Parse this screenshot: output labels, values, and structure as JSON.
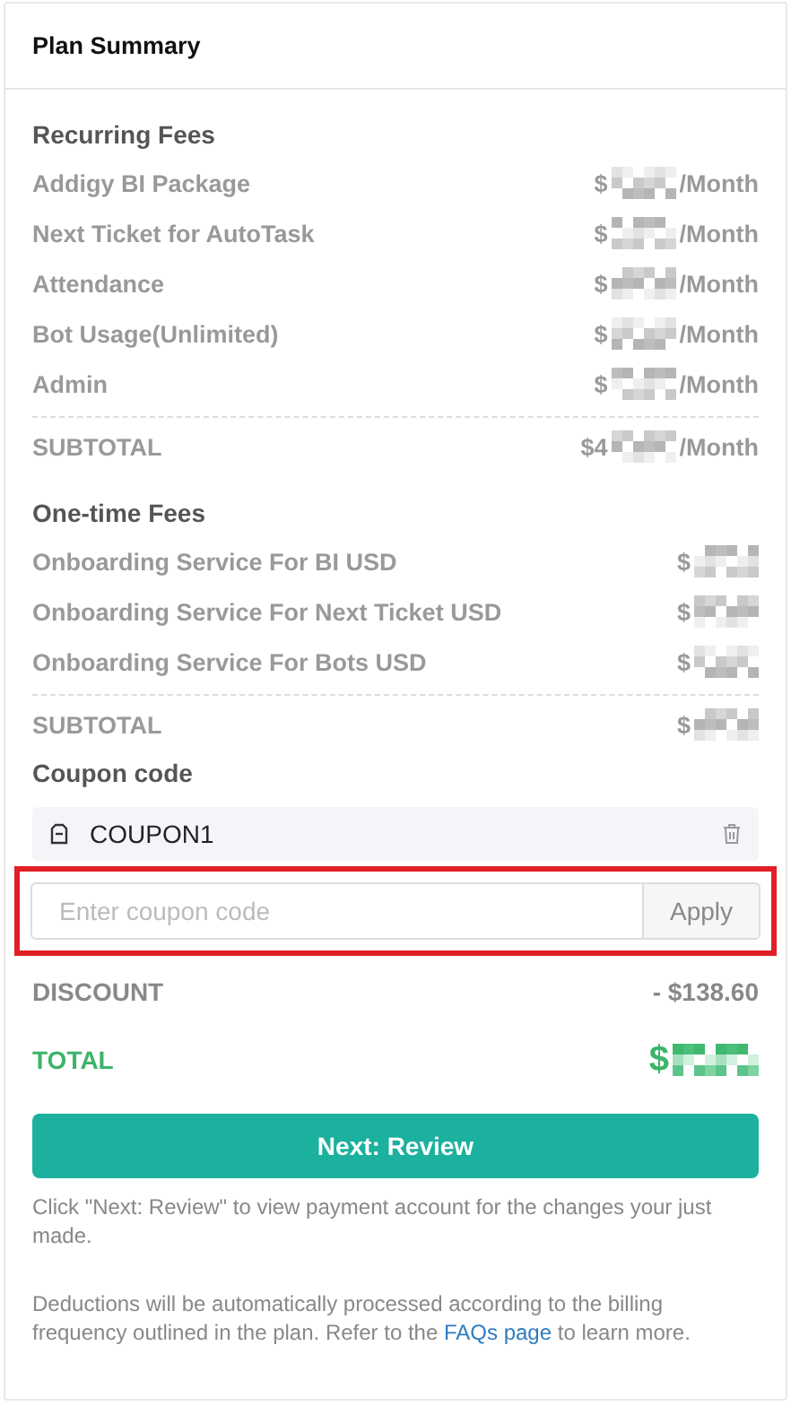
{
  "title": "Plan Summary",
  "recurring": {
    "heading": "Recurring Fees",
    "items": [
      {
        "label": "Addigy BI Package",
        "prefix": "$",
        "suffix": "/Month"
      },
      {
        "label": "Next Ticket for AutoTask",
        "prefix": "$",
        "suffix": "/Month"
      },
      {
        "label": "Attendance",
        "prefix": "$",
        "suffix": "/Month"
      },
      {
        "label": "Bot Usage(Unlimited)",
        "prefix": "$",
        "suffix": "/Month"
      },
      {
        "label": "Admin",
        "prefix": "$",
        "suffix": "/Month"
      }
    ],
    "subtotal": {
      "label": "SUBTOTAL",
      "prefix": "$4",
      "suffix": "/Month"
    }
  },
  "one_time": {
    "heading": "One-time Fees",
    "items": [
      {
        "label": "Onboarding Service For BI USD",
        "prefix": "$"
      },
      {
        "label": "Onboarding Service For Next Ticket USD",
        "prefix": "$"
      },
      {
        "label": "Onboarding Service For Bots USD",
        "prefix": "$"
      }
    ],
    "subtotal": {
      "label": "SUBTOTAL",
      "prefix": "$"
    }
  },
  "coupon": {
    "heading": "Coupon code",
    "applied": "COUPON1",
    "placeholder": "Enter coupon code",
    "button": "Apply",
    "highlighted": true
  },
  "discount": {
    "label": "DISCOUNT",
    "value": "- $138.60"
  },
  "total": {
    "label": "TOTAL",
    "prefix": "$"
  },
  "next_button": "Next: Review",
  "hint": "Click \"Next: Review\" to view payment account for the changes your just made.",
  "note": {
    "before": "Deductions will be automatically processed according to the billing frequency outlined in the plan. Refer to the ",
    "link": "FAQs page",
    "after": " to learn more."
  }
}
